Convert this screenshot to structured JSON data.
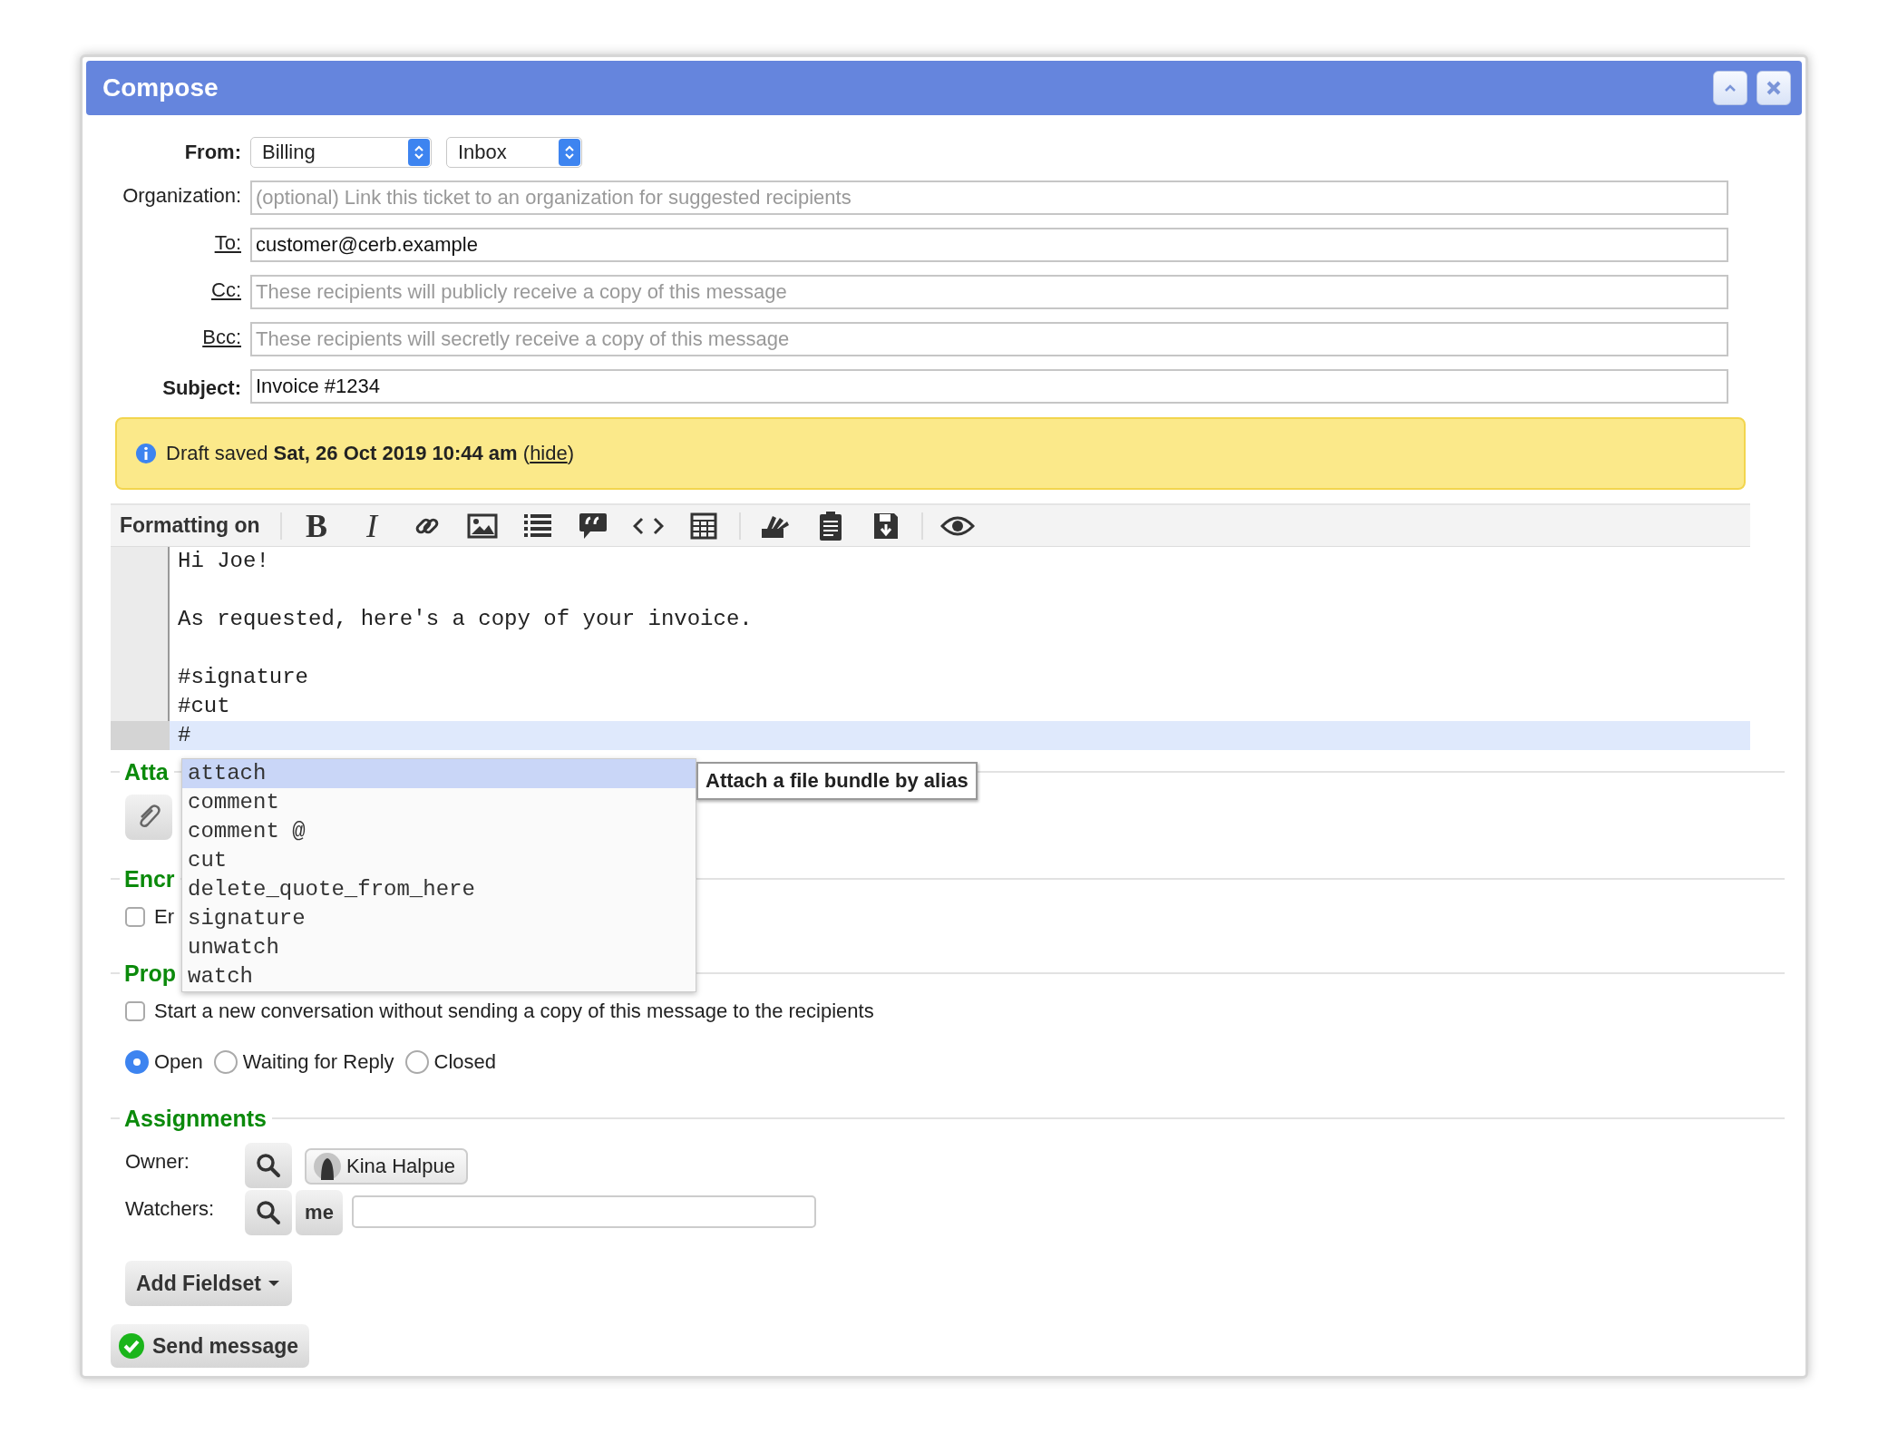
{
  "window": {
    "title": "Compose"
  },
  "from": {
    "label": "From:",
    "selects": [
      {
        "value": "Billing"
      },
      {
        "value": "Inbox"
      }
    ]
  },
  "fields": [
    {
      "label": "Organization:",
      "kind": "plain",
      "placeholder": "(optional) Link this ticket to an organization for suggested recipients"
    },
    {
      "label": "To:",
      "kind": "link",
      "value": "customer@cerb.example"
    },
    {
      "label": "Cc:",
      "kind": "link",
      "placeholder": "These recipients will publicly receive a copy of this message"
    },
    {
      "label": "Bcc:",
      "kind": "link",
      "placeholder": "These recipients will secretly receive a copy of this message"
    },
    {
      "label": "Subject:",
      "kind": "bold",
      "value": "Invoice #1234"
    }
  ],
  "notice": {
    "text": "Draft saved **Sat, 26 Oct 2019 10:44 am** (",
    "link": "hide",
    "text_after": ")"
  },
  "toolbar": {
    "label": "Formatting on",
    "bold_glyph": "B",
    "italic_glyph": "I"
  },
  "editor": {
    "lines": [
      {
        "text": "Hi Joe!",
        "selected": false
      },
      {
        "selected": false
      },
      {
        "text": "As requested, here's a copy of your invoice.",
        "selected": false
      },
      {
        "selected": false
      },
      {
        "text": "#signature",
        "selected": false
      },
      {
        "text": "#cut",
        "selected": false
      },
      {
        "text": "#",
        "selected": true
      }
    ]
  },
  "autocomplete": {
    "items": [
      {
        "text": "attach",
        "selected": true
      },
      {
        "text": "comment",
        "selected": false
      },
      {
        "text": "comment @",
        "selected": false
      },
      {
        "text": "cut",
        "selected": false
      },
      {
        "text": "delete_quote_from_here",
        "selected": false
      },
      {
        "text": "signature",
        "selected": false
      },
      {
        "text": "unwatch",
        "selected": false
      },
      {
        "text": "watch",
        "selected": false
      }
    ],
    "tooltip": "Attach a file bundle by alias"
  },
  "attachments": {
    "title": "Atta"
  },
  "encryption": {
    "title": "Encr",
    "checkbox": {
      "label": "Er",
      "checked": false
    }
  },
  "properties": {
    "title": "Prop",
    "checkbox": {
      "label": "Start a new conversation without sending a copy of this message to the recipients",
      "checked": false
    },
    "statuses": [
      {
        "label": "Open",
        "selected": true
      },
      {
        "label": "Waiting for Reply",
        "selected": false
      },
      {
        "label": "Closed",
        "selected": false
      }
    ]
  },
  "assignments": {
    "title": "Assignments",
    "owner": {
      "label": "Owner:",
      "chip": "Kina Halpue"
    },
    "watchers": {
      "label": "Watchers:",
      "me": "me"
    }
  },
  "buttons": {
    "add_fieldset": "Add Fieldset",
    "send": "Send message"
  }
}
